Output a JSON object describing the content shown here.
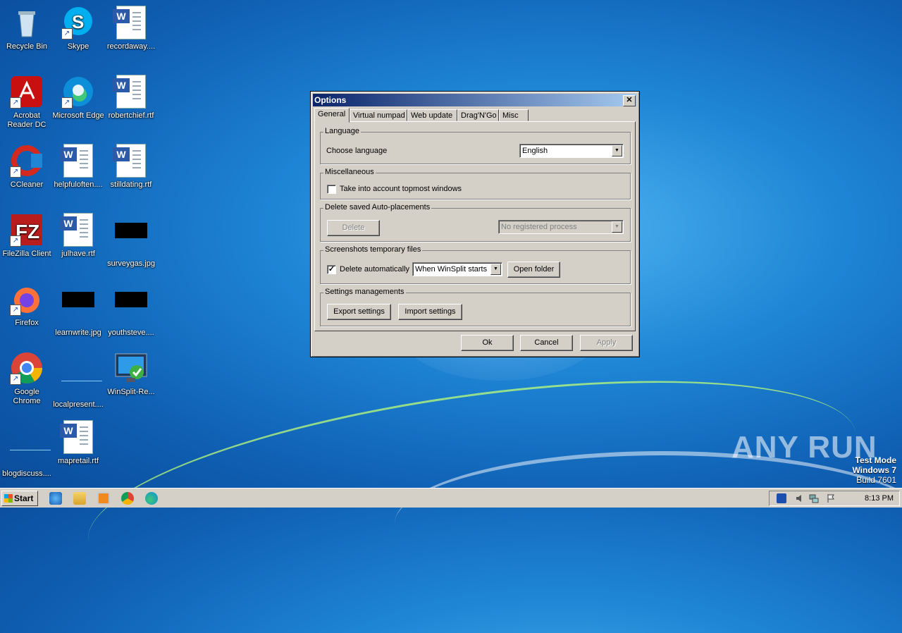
{
  "desktop": {
    "icons": [
      {
        "label": "Recycle Bin"
      },
      {
        "label": "Skype"
      },
      {
        "label": "recordaway...."
      },
      {
        "label": "Acrobat Reader DC"
      },
      {
        "label": "Microsoft Edge"
      },
      {
        "label": "robertchief.rtf"
      },
      {
        "label": "CCleaner"
      },
      {
        "label": "helpfuloften...."
      },
      {
        "label": "stilldating.rtf"
      },
      {
        "label": "FileZilla Client"
      },
      {
        "label": "julhave.rtf"
      },
      {
        "label": "surveygas.jpg"
      },
      {
        "label": "Firefox"
      },
      {
        "label": "learnwrite.jpg"
      },
      {
        "label": "youthsteve...."
      },
      {
        "label": "Google Chrome"
      },
      {
        "label": "localpresent...."
      },
      {
        "label": "WinSplit-Re..."
      },
      {
        "label": "blogdiscuss...."
      },
      {
        "label": "mapretail.rtf"
      }
    ]
  },
  "dialog": {
    "title": "Options",
    "close_glyph": "✕",
    "tabs": [
      "General",
      "Virtual numpad",
      "Web update",
      "Drag'N'Go",
      "Misc"
    ],
    "language": {
      "group_label": "Language",
      "choose_label": "Choose language",
      "selected": "English"
    },
    "misc": {
      "group_label": "Miscellaneous",
      "topmost_label": "Take into account topmost windows",
      "topmost_checked": false
    },
    "autoplacements": {
      "group_label": "Delete saved Auto-placements",
      "delete_label": "Delete",
      "process_selected": "No registered process"
    },
    "screenshots": {
      "group_label": "Screenshots temporary files",
      "delete_auto_label": "Delete automatically",
      "delete_auto_checked": true,
      "when_selected": "When WinSplit starts",
      "open_folder_label": "Open folder"
    },
    "settings": {
      "group_label": "Settings managements",
      "export_label": "Export settings",
      "import_label": "Import settings"
    },
    "footer": {
      "ok": "Ok",
      "cancel": "Cancel",
      "apply": "Apply"
    }
  },
  "taskbar": {
    "start_label": "Start",
    "clock": "8:13 PM"
  },
  "watermark": {
    "line1": "Test Mode",
    "line2": "Windows 7",
    "line3": "Build 7601",
    "brand": "ANY RUN"
  }
}
